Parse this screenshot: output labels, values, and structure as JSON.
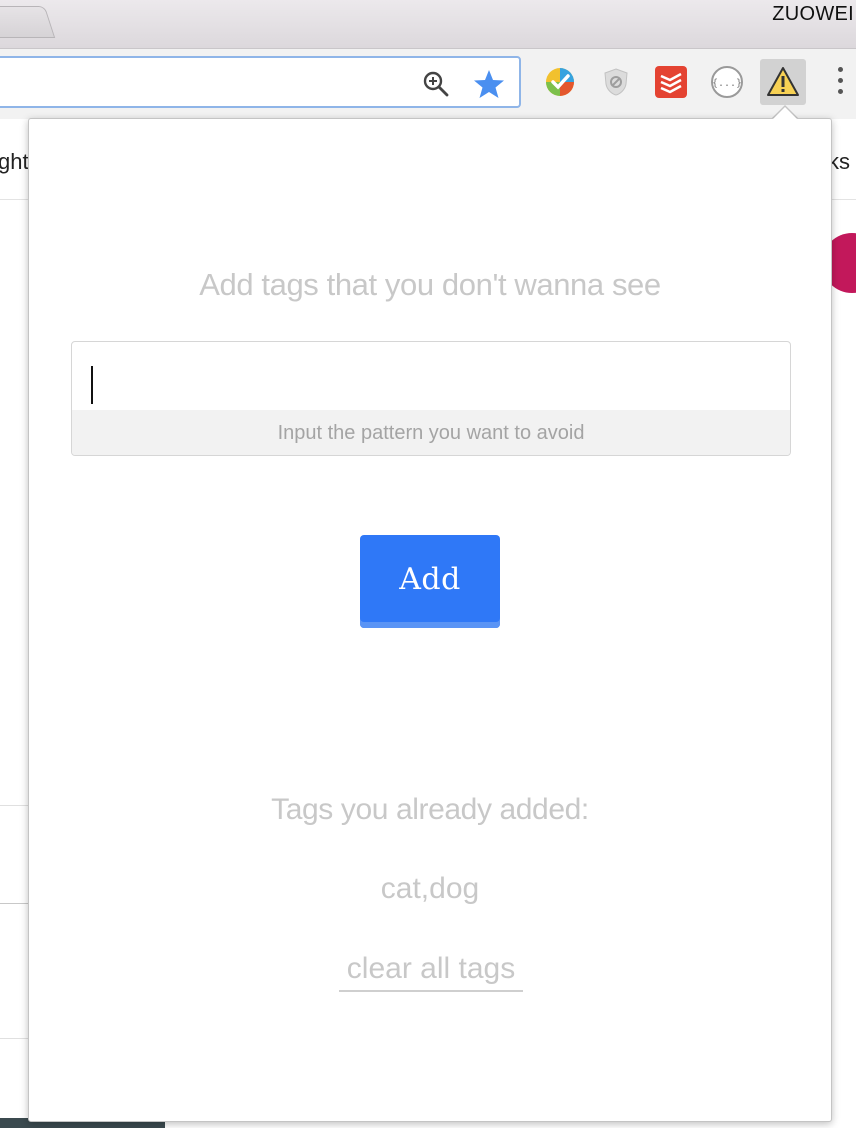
{
  "browser": {
    "profile_name": "ZUOWEI",
    "bookmarks_left_fragment": "ght",
    "bookmarks_right_fragment": "ks"
  },
  "icons": {
    "zoom": "zoom-in-icon",
    "bookmark_star": "star-icon",
    "extensions": [
      "colorful-extension-icon",
      "shield-extension-icon",
      "todoist-extension-icon",
      "json-formatter-extension-icon",
      "warning-extension-icon"
    ],
    "menu": "more-vert-icon"
  },
  "colors": {
    "accent": "#2f78f7",
    "muted_text": "#c8c8c8",
    "star": "#4a8ff0"
  },
  "popup": {
    "heading": "Add tags that you don't wanna see",
    "input": {
      "value": "",
      "hint": "Input the pattern you want to avoid"
    },
    "add_button": "Add",
    "added_label": "Tags you already added:",
    "tags": "cat,dog",
    "clear_link": "clear all tags"
  }
}
